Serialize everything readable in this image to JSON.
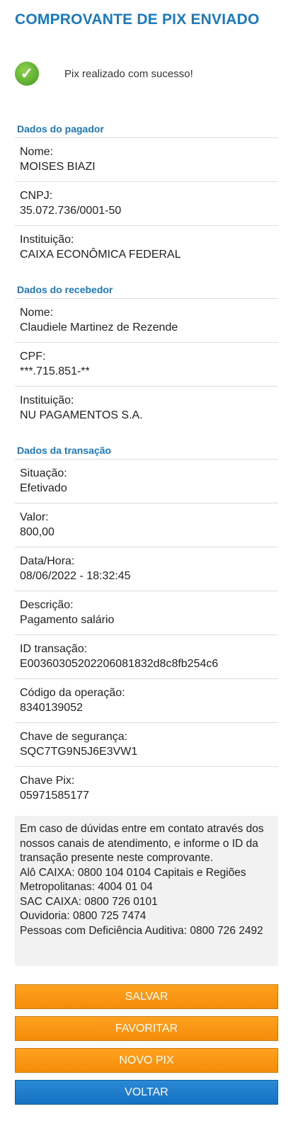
{
  "title": "COMPROVANTE DE PIX ENVIADO",
  "success": "Pix realizado com sucesso!",
  "sections": [
    {
      "heading": "Dados do pagador",
      "rows": [
        {
          "label": "Nome:",
          "value": "MOISES BIAZI"
        },
        {
          "label": "CNPJ:",
          "value": "35.072.736/0001-50"
        },
        {
          "label": "Instituição:",
          "value": "CAIXA ECONÔMICA FEDERAL"
        }
      ]
    },
    {
      "heading": "Dados do recebedor",
      "rows": [
        {
          "label": "Nome:",
          "value": "Claudiele Martinez de Rezende"
        },
        {
          "label": "CPF:",
          "value": "***.715.851-**"
        },
        {
          "label": "Instituição:",
          "value": "NU PAGAMENTOS S.A."
        }
      ]
    },
    {
      "heading": "Dados da transação",
      "rows": [
        {
          "label": "Situação:",
          "value": "Efetivado"
        },
        {
          "label": "Valor:",
          "value": "800,00"
        },
        {
          "label": "Data/Hora:",
          "value": "08/06/2022 - 18:32:45"
        },
        {
          "label": "Descrição:",
          "value": "Pagamento salário"
        },
        {
          "label": "ID transação:",
          "value": "E00360305202206081832d8c8fb254c6"
        },
        {
          "label": "Código da operação:",
          "value": "8340139052"
        },
        {
          "label": "Chave de segurança:",
          "value": "SQC7TG9N5J6E3VW1"
        },
        {
          "label": "Chave Pix:",
          "value": "05971585177"
        }
      ]
    }
  ],
  "info": [
    "Em caso de dúvidas entre em contato através dos nossos canais de atendimento, e informe o ID da transação presente neste comprovante.",
    "Alô CAIXA: 0800 104 0104 Capitais e Regiões Metropolitanas: 4004 01 04",
    "SAC CAIXA: 0800 726 0101",
    "Ouvidoria: 0800 725 7474",
    "Pessoas com Deficiência Auditiva: 0800 726 2492"
  ],
  "buttons": {
    "save": "SALVAR",
    "favorite": "FAVORITAR",
    "new_pix": "NOVO PIX",
    "back": "VOLTAR"
  }
}
